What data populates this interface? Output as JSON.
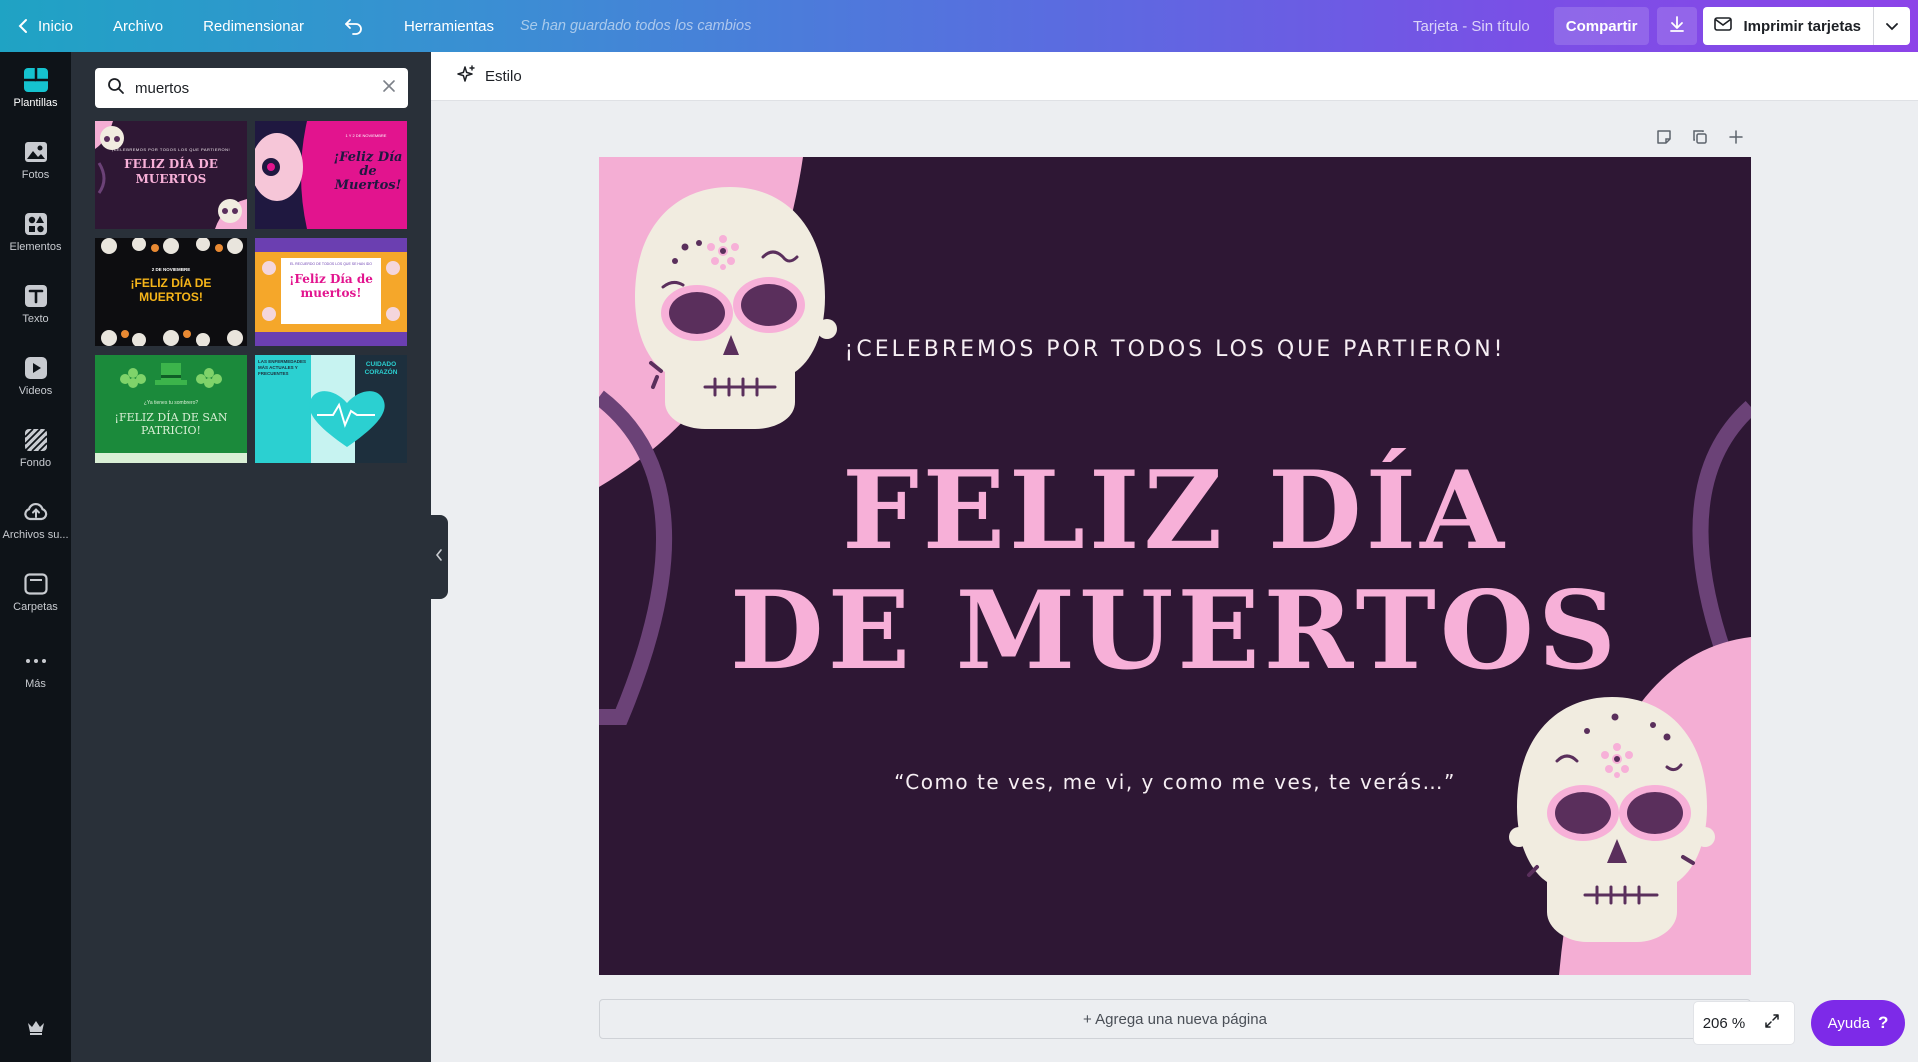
{
  "topbar": {
    "home_label": "Inicio",
    "file_label": "Archivo",
    "resize_label": "Redimensionar",
    "tools_label": "Herramientas",
    "saved_status": "Se han guardado todos los cambios",
    "doc_title": "Tarjeta - Sin título",
    "share_label": "Compartir",
    "print_label": "Imprimir tarjetas"
  },
  "rail": {
    "items": [
      {
        "label": "Plantillas",
        "icon": "templates-icon"
      },
      {
        "label": "Fotos",
        "icon": "photos-icon"
      },
      {
        "label": "Elementos",
        "icon": "elements-icon"
      },
      {
        "label": "Texto",
        "icon": "text-icon"
      },
      {
        "label": "Videos",
        "icon": "video-icon"
      },
      {
        "label": "Fondo",
        "icon": "background-icon"
      },
      {
        "label": "Archivos su...",
        "icon": "upload-icon"
      },
      {
        "label": "Carpetas",
        "icon": "folder-icon"
      },
      {
        "label": "Más",
        "icon": "more-icon"
      }
    ]
  },
  "panel": {
    "search_value": "muertos",
    "templates": [
      {
        "name": "template-feliz-dia-de-muertos-purple",
        "title": "FELIZ DÍA DE MUERTOS",
        "subtitle": "¡CELEBREMOS POR TODOS LOS QUE PARTIERON!"
      },
      {
        "name": "template-feliz-dia-de-muertos-pink",
        "title": "¡Feliz Día de Muertos!",
        "subtitle": "1 Y 2 DE NOVIEMBRE"
      },
      {
        "name": "template-feliz-dia-de-muertos-black",
        "title": "¡FELIZ DÍA DE MUERTOS!",
        "subtitle": "2 DE NOVIEMBRE"
      },
      {
        "name": "template-feliz-dia-de-muertos-marigold",
        "title": "¡Feliz Día de muertos!",
        "subtitle": "EL RECUERDO DE TODOS LOS QUE SE HAN IDO"
      },
      {
        "name": "template-san-patricio",
        "title": "¡FELIZ DÍA DE SAN PATRICIO!",
        "subtitle": "¿Ya tienes tu sombrero?"
      },
      {
        "name": "template-cuidado-corazon",
        "title": "CUIDADO CORAZÓN",
        "subtitle": "LAS ENFERMEDADES MÁS ACTUALES Y FRECUENTES"
      }
    ]
  },
  "workspace": {
    "style_label": "Estilo",
    "add_page_label": "+ Agrega una nueva página",
    "zoom_label": "206 %",
    "help_label": "Ayuda",
    "help_icon": "?"
  },
  "canvas": {
    "top_text": "¡CELEBREMOS POR TODOS LOS QUE PARTIERON!",
    "title_line1": "FELIZ DÍA",
    "title_line2": "DE MUERTOS",
    "quote": "“Como te ves, me vi, y como me ves, te verás…”",
    "colors": {
      "background": "#2e1734",
      "pink": "#f7b0d8",
      "accent_arc": "#6b4277",
      "skull": "#f1ece0",
      "skull_eyes": "#5a2f5c"
    }
  }
}
